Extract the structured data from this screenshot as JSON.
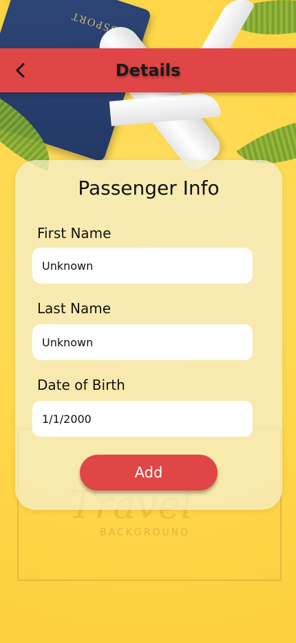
{
  "header": {
    "title": "Details",
    "back_icon": "chevron-left-icon"
  },
  "card": {
    "title": "Passenger Info",
    "fields": [
      {
        "label": "First Name",
        "value": "Unknown"
      },
      {
        "label": "Last Name",
        "value": "Unknown"
      },
      {
        "label": "Date of Birth",
        "value": "1/1/2000"
      }
    ],
    "add_label": "Add"
  },
  "colors": {
    "accent": "#e04646",
    "background": "#ffd84f",
    "card": "#f6eec8"
  }
}
